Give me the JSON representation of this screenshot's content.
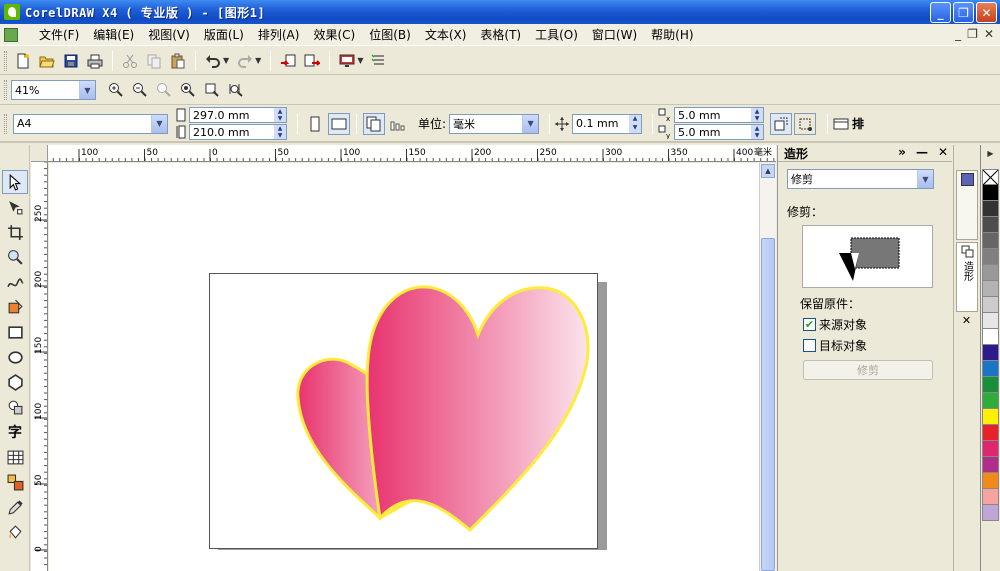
{
  "window": {
    "title": "CorelDRAW X4 ( 专业版 ) - [图形1]",
    "minimize": "_",
    "restore": "❐",
    "close": "✕"
  },
  "menu": {
    "items": [
      "文件(F)",
      "编辑(E)",
      "视图(V)",
      "版面(L)",
      "排列(A)",
      "效果(C)",
      "位图(B)",
      "文本(X)",
      "表格(T)",
      "工具(O)",
      "窗口(W)",
      "帮助(H)"
    ],
    "mdi_min": "_",
    "mdi_restore": "❐",
    "mdi_close": "✕"
  },
  "zoom": {
    "value": "41%"
  },
  "property_bar": {
    "paper_size": "A4",
    "width": "297.0 mm",
    "height": "210.0 mm",
    "unit_label": "单位:",
    "unit_value": "毫米",
    "nudge": "0.1 mm",
    "dup_x": "5.0 mm",
    "dup_y": "5.0 mm",
    "overflow_label": "排"
  },
  "hruler_ticks": [
    "100",
    "50",
    "0",
    "50",
    "100",
    "150",
    "200",
    "250",
    "300",
    "350",
    "400"
  ],
  "hruler_unit": "毫米",
  "vruler_ticks": [
    "250",
    "200",
    "150",
    "100",
    "50",
    "0"
  ],
  "docker": {
    "title": "造形",
    "mode_value": "修剪",
    "section_label": "修剪：",
    "keep_label": "保留原件：",
    "source_label": "来源对象",
    "source_checked": true,
    "target_label": "目标对象",
    "target_checked": false,
    "apply_label": "修剪"
  },
  "docker_tabs": [
    {
      "label": "造形",
      "active": true
    }
  ],
  "palette_colors": [
    "#000000",
    "#333333",
    "#4d4d4d",
    "#666666",
    "#808080",
    "#999999",
    "#b3b3b3",
    "#cccccc",
    "#e6e6e6",
    "#ffffff",
    "#2e1a8a",
    "#1a75c7",
    "#1a8f3a",
    "#2eac3c",
    "#ffef00",
    "#e8202a",
    "#e0266e",
    "#b02e8a",
    "#f28a1a",
    "#f7a3a0",
    "#bfa6d6"
  ],
  "shapes": {
    "heart_fill_start": "#e8336e",
    "heart_fill_end": "#fbe3ec",
    "heart_outline": "#ffeb3b"
  }
}
